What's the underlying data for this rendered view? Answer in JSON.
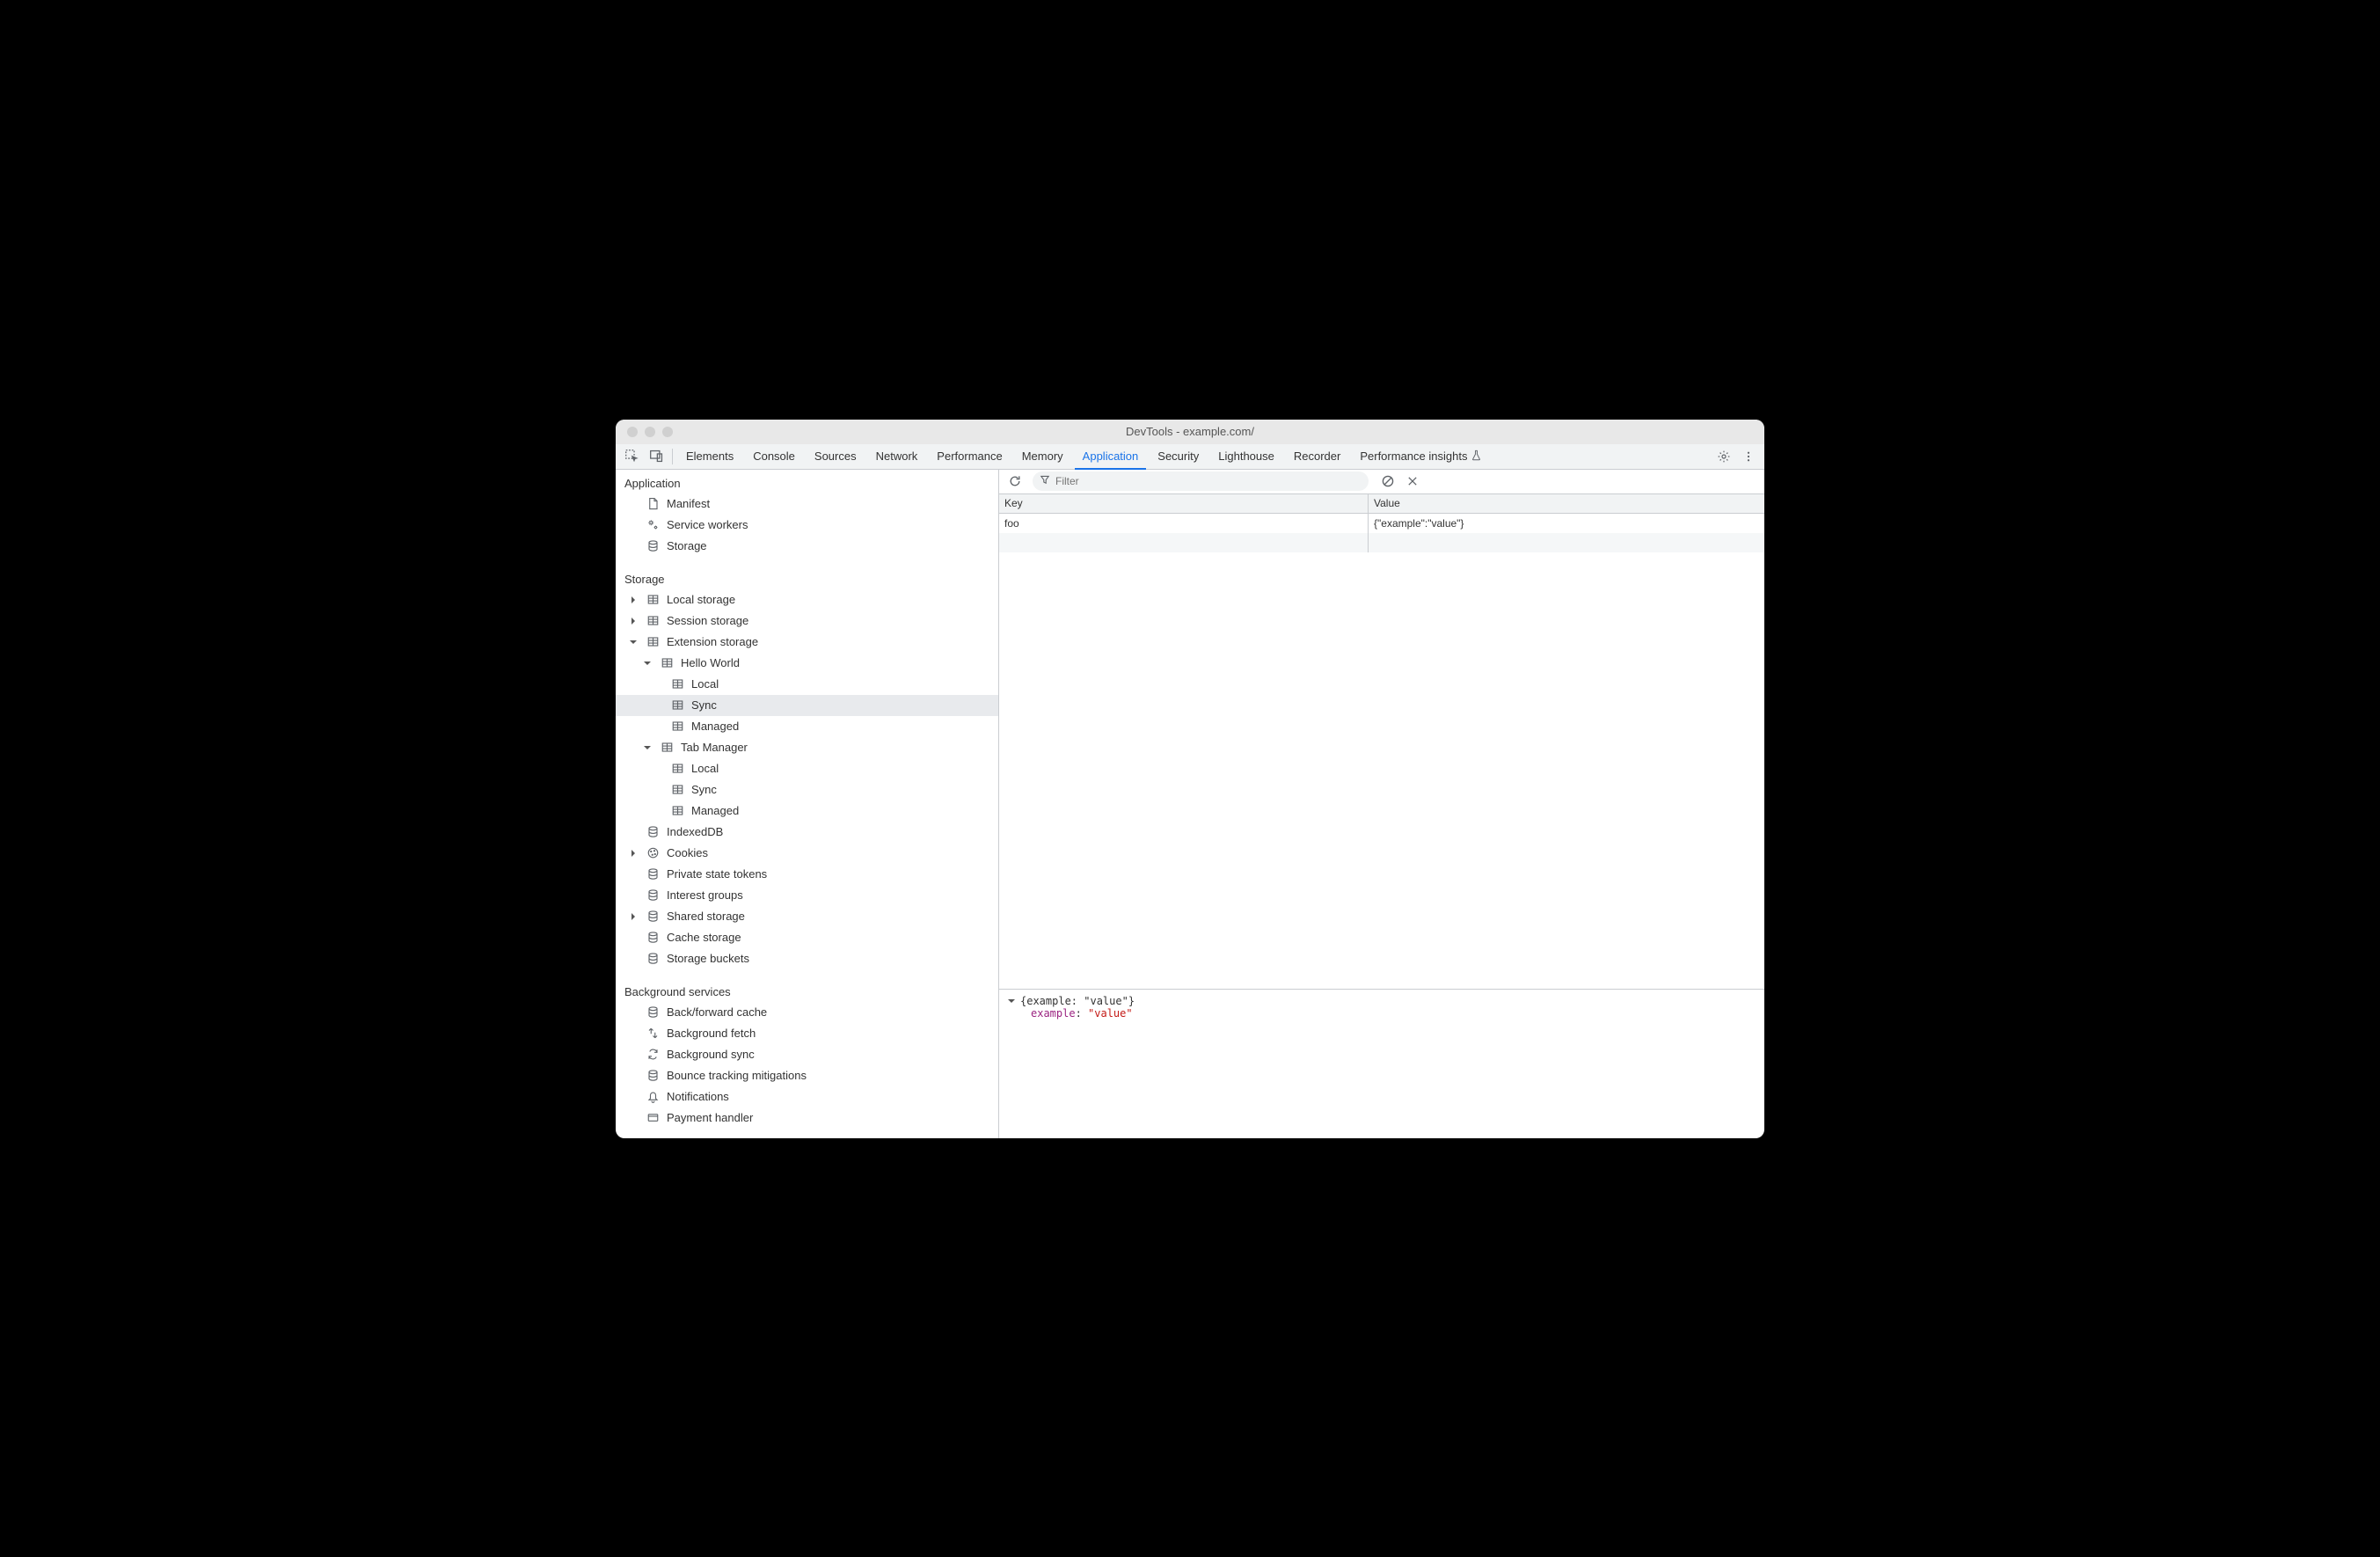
{
  "window": {
    "title": "DevTools - example.com/"
  },
  "tabs": {
    "items": [
      "Elements",
      "Console",
      "Sources",
      "Network",
      "Performance",
      "Memory",
      "Application",
      "Security",
      "Lighthouse",
      "Recorder",
      "Performance insights"
    ],
    "active": "Application"
  },
  "sidebar": {
    "sections": {
      "app": {
        "label": "Application",
        "items": [
          "Manifest",
          "Service workers",
          "Storage"
        ]
      },
      "storage": {
        "label": "Storage",
        "local_storage": "Local storage",
        "session_storage": "Session storage",
        "ext_storage": "Extension storage",
        "hello_world": "Hello World",
        "local": "Local",
        "sync": "Sync",
        "managed": "Managed",
        "tab_manager": "Tab Manager",
        "indexeddb": "IndexedDB",
        "cookies": "Cookies",
        "pst": "Private state tokens",
        "interest": "Interest groups",
        "shared": "Shared storage",
        "cache": "Cache storage",
        "buckets": "Storage buckets"
      },
      "bg": {
        "label": "Background services",
        "bfcache": "Back/forward cache",
        "bgfetch": "Background fetch",
        "bgsync": "Background sync",
        "bounce": "Bounce tracking mitigations",
        "notif": "Notifications",
        "pay": "Payment handler"
      }
    }
  },
  "filter": {
    "placeholder": "Filter"
  },
  "grid": {
    "key_header": "Key",
    "val_header": "Value",
    "rows": [
      {
        "key": "foo",
        "value": "{\"example\":\"value\"}"
      }
    ]
  },
  "eval": {
    "summary": "{example: \"value\"}",
    "prop_key": "example",
    "prop_val": "\"value\""
  }
}
